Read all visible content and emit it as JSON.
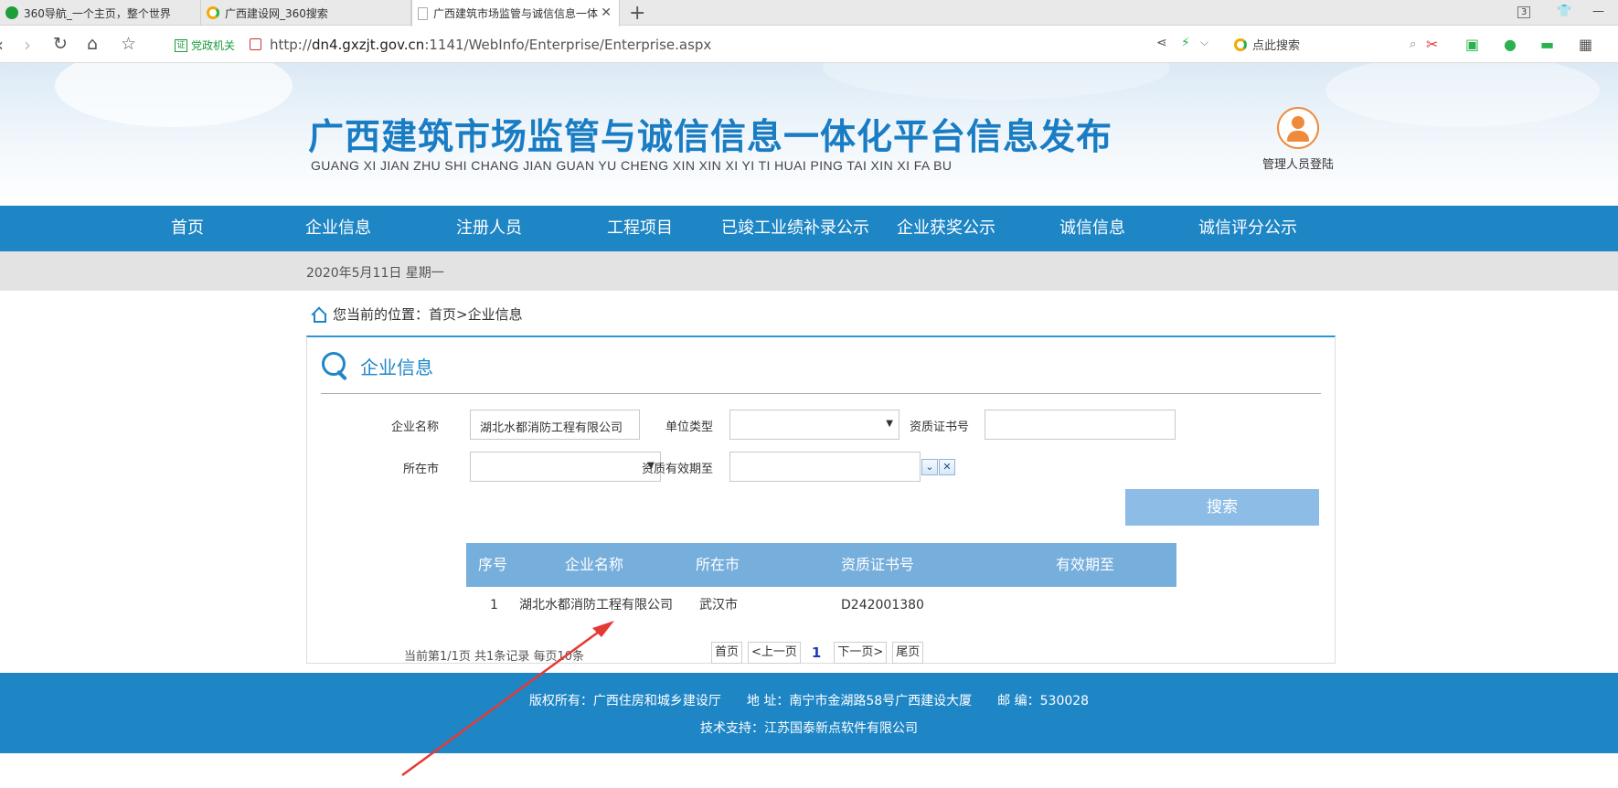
{
  "browser": {
    "tabs": [
      {
        "title": "360导航_一个主页，整个世界",
        "icon_color": "#1f9d3a"
      },
      {
        "title": "广西建设网_360搜索",
        "icon_color": "#f2a900"
      },
      {
        "title": "广西建筑市场监管与诚信信息一体化",
        "icon_color": "#cccccc"
      }
    ],
    "new_tab": "+",
    "tab_count": "3",
    "gov_badge": "党政机关",
    "url_prefix": "http://",
    "url_host": "dn4.gxzjt.gov.cn",
    "url_path": ":1141/WebInfo/Enterprise/Enterprise.aspx",
    "search_placeholder": "点此搜索"
  },
  "header": {
    "title": "广西建筑市场监管与诚信信息一体化平台信息发布",
    "subtitle": "GUANG XI JIAN ZHU SHI CHANG JIAN GUAN YU CHENG XIN XIN XI YI TI HUAI PING TAI XIN XI FA BU",
    "admin_login": "管理人员登陆"
  },
  "nav": [
    "首页",
    "企业信息",
    "注册人员",
    "工程项目",
    "已竣工业绩补录公示",
    "企业获奖公示",
    "诚信信息",
    "诚信评分公示"
  ],
  "date": "2020年5月11日 星期一",
  "breadcrumb": {
    "prefix": "您当前的位置：",
    "home": "首页",
    "separator": " >",
    "current": "企业信息"
  },
  "panel": {
    "title": "企业信息",
    "form": {
      "company_name_label": "企业名称",
      "company_name_value": "湖北水都消防工程有限公司",
      "unit_type_label": "单位类型",
      "unit_type_value": "",
      "cert_no_label": "资质证书号",
      "cert_no_value": "",
      "city_label": "所在市",
      "city_value": "",
      "valid_until_label": "资质有效期至",
      "valid_until_value": "",
      "dropdown_btn": "⌄",
      "clear_btn": "✕",
      "search_button": "搜索"
    },
    "table": {
      "headers": [
        "序号",
        "企业名称",
        "所在市",
        "资质证书号",
        "有效期至"
      ],
      "rows": [
        [
          "1",
          "湖北水都消防工程有限公司",
          "武汉市",
          "D242001380",
          ""
        ]
      ]
    },
    "pager": {
      "info": "当前第1/1页 共1条记录 每页10条",
      "first": "首页",
      "prev": "<上一页",
      "current": "1",
      "next": "下一页>",
      "last": "尾页"
    }
  },
  "footer": {
    "line1": "版权所有：广西住房和城乡建设厅　　地 址：南宁市金湖路58号广西建设大厦　　邮 编：530028",
    "line2": "技术支持：江苏国泰新点软件有限公司"
  },
  "colors": {
    "primary": "#1f86c6",
    "table_header": "#76aedc",
    "search_button": "#8dbde6",
    "annotation_arrow": "#e53935"
  }
}
